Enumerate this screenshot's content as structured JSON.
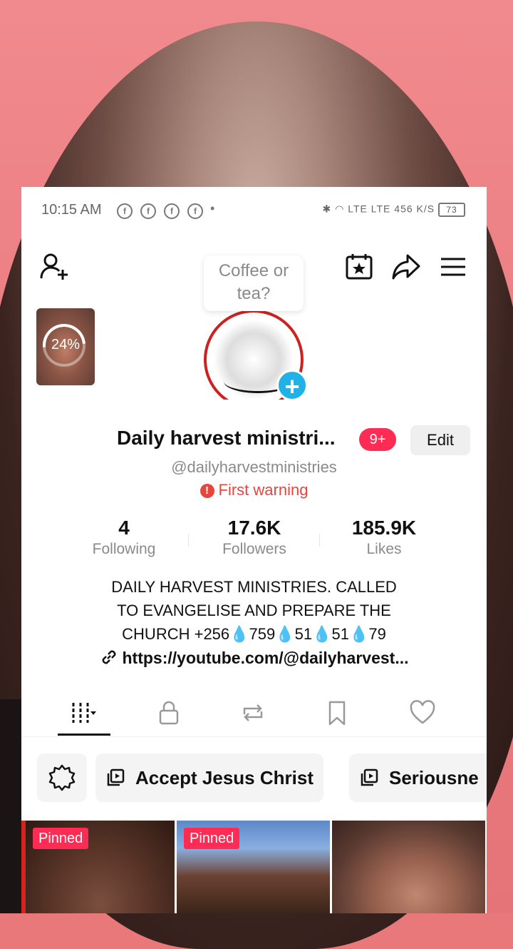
{
  "status_bar": {
    "time": "10:15 AM",
    "fb_icon": "f",
    "dot": "•",
    "network": "LTE LTE 456 K/S",
    "battery": "73"
  },
  "tooltip": {
    "text": "Coffee or tea?"
  },
  "story": {
    "progress_text": "24%",
    "progress": 0.24
  },
  "profile": {
    "name": "Daily harvest ministri...",
    "notification_badge": "9+",
    "edit_label": "Edit",
    "handle": "@dailyharvestministries",
    "warning": "First warning",
    "warning_icon": "!"
  },
  "stats": [
    {
      "value": "4",
      "label": "Following"
    },
    {
      "value": "17.6K",
      "label": "Followers"
    },
    {
      "value": "185.9K",
      "label": "Likes"
    }
  ],
  "bio": "DAILY HARVEST MINISTRIES.  CALLED\nTO EVANGELISE AND PREPARE THE\nCHURCH +256💧759💧51💧51💧79",
  "link": "https://youtube.com/@dailyharvest...",
  "collections": [
    {
      "label": "Accept Jesus Christ"
    },
    {
      "label": "Seriousne"
    }
  ],
  "videos": [
    {
      "badge": "Pinned"
    },
    {
      "badge": "Pinned"
    },
    {
      "badge": ""
    }
  ],
  "colors": {
    "accent": "#fe2c55",
    "warning": "#e8453c",
    "plus": "#20b1e6"
  }
}
